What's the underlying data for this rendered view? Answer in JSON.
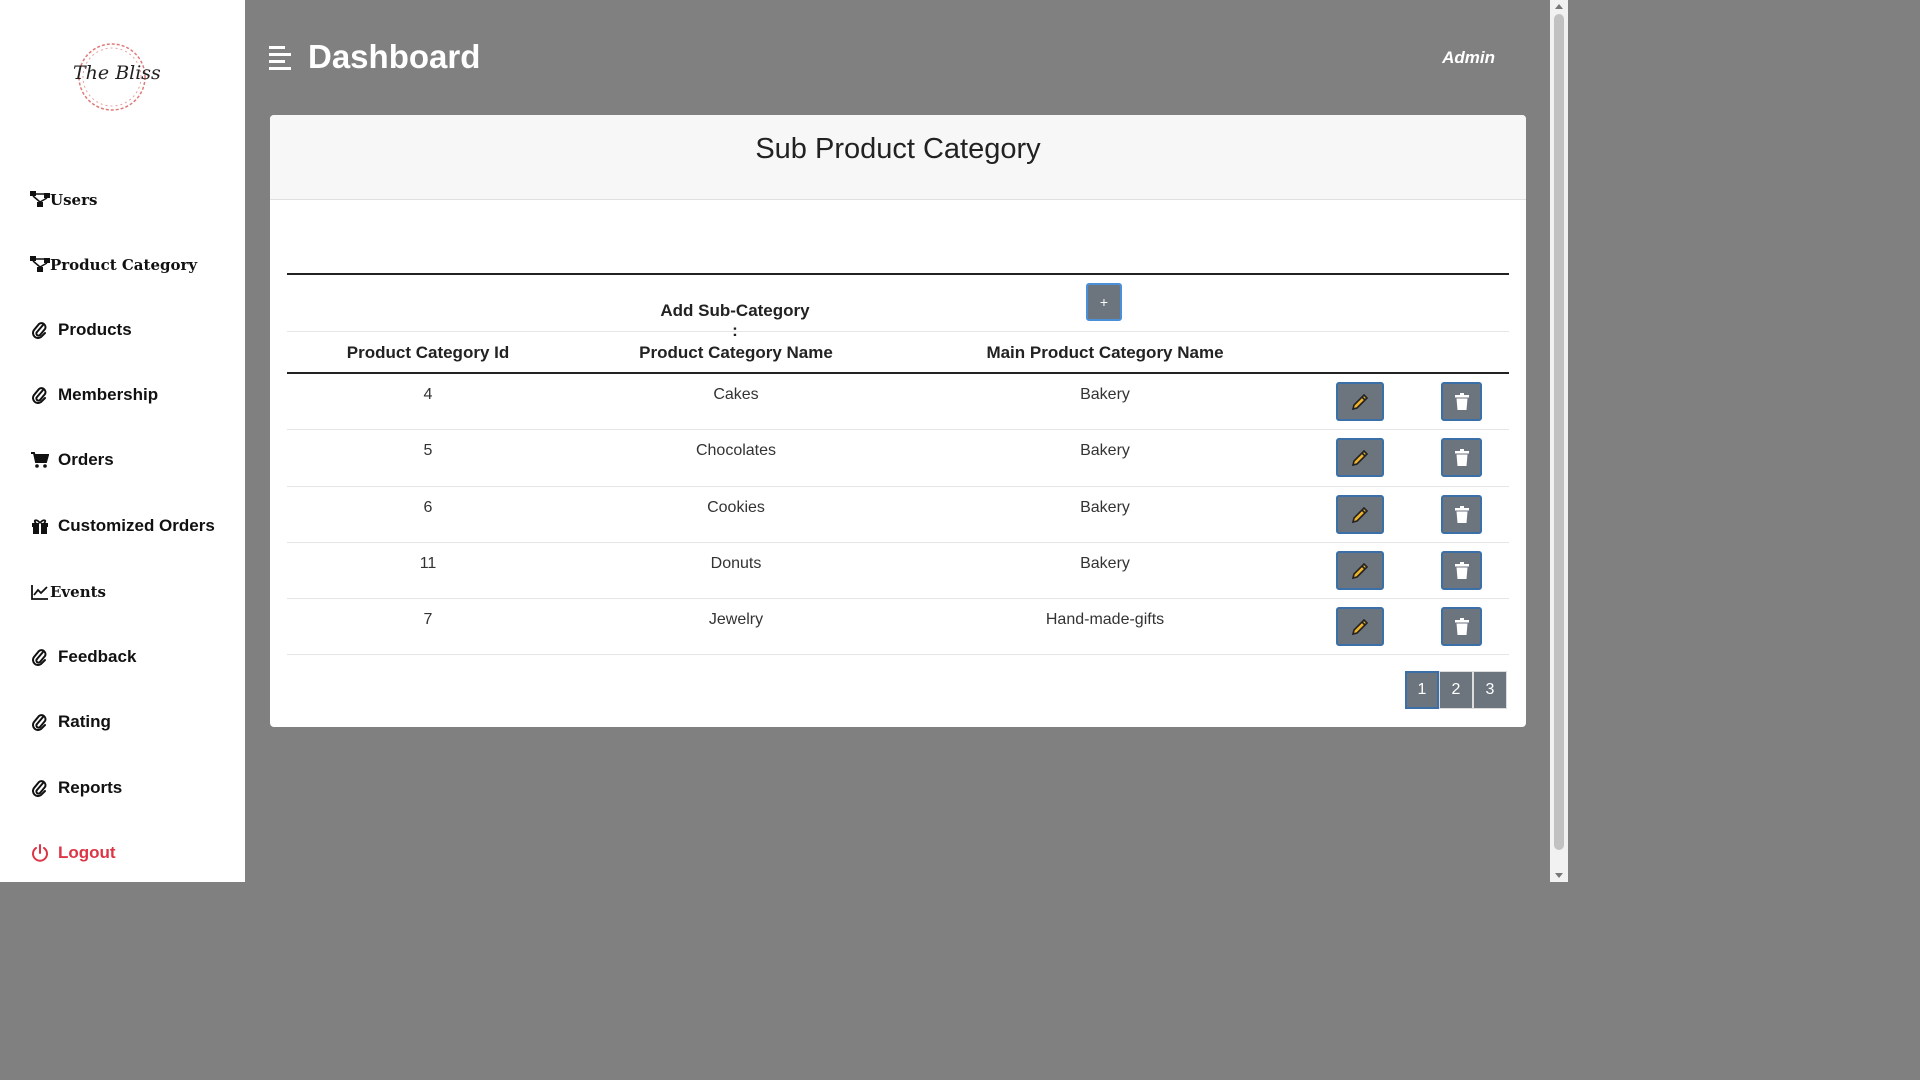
{
  "logo": {
    "text": "The Bliss"
  },
  "sidebar": {
    "items": [
      {
        "label": "Users",
        "icon": "sitemap-icon"
      },
      {
        "label": "Product Category",
        "icon": "sitemap-icon"
      },
      {
        "label": "Products",
        "icon": "paperclip-icon"
      },
      {
        "label": "Membership",
        "icon": "paperclip-icon"
      },
      {
        "label": "Orders",
        "icon": "cart-icon"
      },
      {
        "label": "Customized Orders",
        "icon": "gift-icon"
      },
      {
        "label": "Events",
        "icon": "line-chart-icon"
      },
      {
        "label": "Feedback",
        "icon": "paperclip-icon"
      },
      {
        "label": "Rating",
        "icon": "paperclip-icon"
      },
      {
        "label": "Reports",
        "icon": "paperclip-icon"
      },
      {
        "label": "Logout",
        "icon": "power-icon"
      }
    ]
  },
  "header": {
    "title": "Dashboard",
    "user": "Admin"
  },
  "card": {
    "title": "Sub Product Category",
    "add_label": "Add Sub-Category :",
    "add_button": "+",
    "columns": [
      "Product Category Id",
      "Product Category Name",
      "Main Product Category Name"
    ],
    "rows": [
      {
        "id": "4",
        "name": "Cakes",
        "main": "Bakery"
      },
      {
        "id": "5",
        "name": "Chocolates",
        "main": "Bakery"
      },
      {
        "id": "6",
        "name": "Cookies",
        "main": "Bakery"
      },
      {
        "id": "11",
        "name": "Donuts",
        "main": "Bakery"
      },
      {
        "id": "7",
        "name": "Jewelry",
        "main": "Hand-made-gifts"
      }
    ],
    "pages": [
      "1",
      "2",
      "3"
    ],
    "active_page": "1"
  },
  "colors": {
    "background": "#808080",
    "button": "#6c757d",
    "pencil": "#f0b429",
    "logout": "#dc3545"
  }
}
